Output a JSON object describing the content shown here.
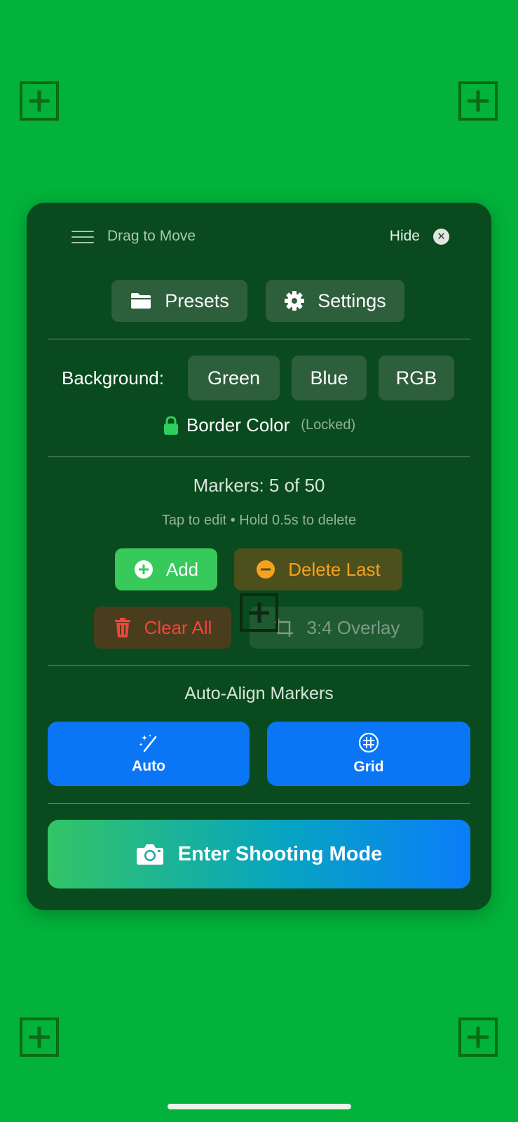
{
  "panel": {
    "drag_label": "Drag to Move",
    "hide_label": "Hide",
    "close_glyph": "✕",
    "presets_label": "Presets",
    "settings_label": "Settings"
  },
  "background": {
    "label": "Background:",
    "options": [
      "Green",
      "Blue",
      "RGB"
    ]
  },
  "border": {
    "label": "Border Color",
    "status": "(Locked)"
  },
  "markers": {
    "title": "Markers: 5 of 50",
    "hint": "Tap to edit • Hold 0.5s to delete",
    "add_label": "Add",
    "delete_last_label": "Delete Last",
    "clear_all_label": "Clear All",
    "overlay_label": "3:4 Overlay"
  },
  "auto_align": {
    "title": "Auto-Align Markers",
    "auto_label": "Auto",
    "grid_label": "Grid"
  },
  "shoot_label": "Enter Shooting Mode",
  "colors": {
    "screen_background": "#02b23a",
    "panel_background": "#094a1f",
    "accent_blue": "#0a76f5",
    "add_green": "#37c95a",
    "warning_orange": "#f6a21a",
    "danger_red": "#f2453a"
  },
  "icons": [
    "hamburger-icon",
    "close-icon",
    "folder-icon",
    "gear-icon",
    "lock-icon",
    "plus-circle-icon",
    "minus-circle-icon",
    "trash-icon",
    "crop-icon",
    "magic-wand-icon",
    "grid-icon",
    "camera-icon",
    "marker-crosshair-icon"
  ]
}
